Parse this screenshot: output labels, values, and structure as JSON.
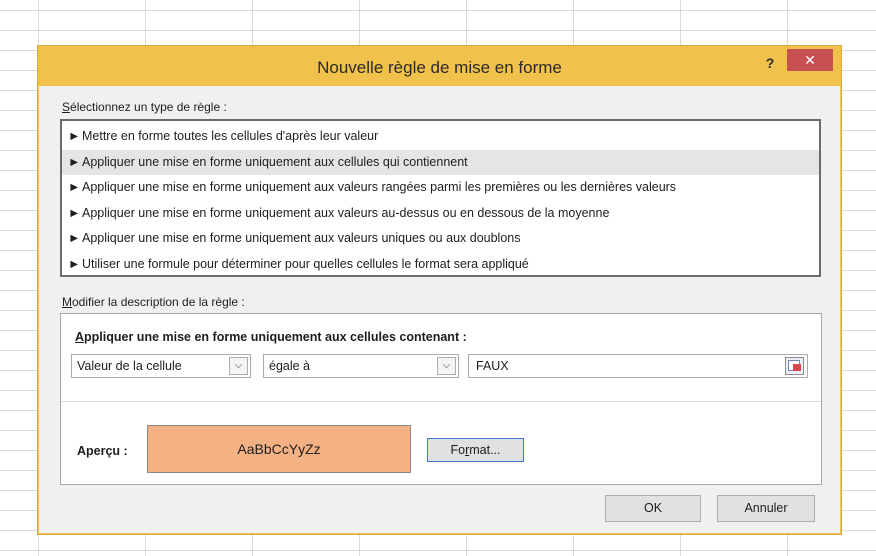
{
  "dialog": {
    "title": "Nouvelle règle de mise en forme",
    "help_label": "?",
    "close_label": "✕"
  },
  "rule_type": {
    "label_prefix": "S",
    "label_rest": "électionnez un type de règle :",
    "items": [
      "Mettre en forme toutes les cellules d'après leur valeur",
      "Appliquer une mise en forme uniquement aux cellules qui contiennent",
      "Appliquer une mise en forme uniquement aux valeurs rangées parmi les premières ou les dernières valeurs",
      "Appliquer une mise en forme uniquement aux valeurs au-dessus ou en dessous de la moyenne",
      "Appliquer une mise en forme uniquement aux valeurs uniques ou aux doublons",
      "Utiliser une formule pour déterminer pour quelles cellules le format sera appliqué"
    ],
    "selected_index": 1,
    "bullet": "►"
  },
  "description": {
    "label_prefix": "M",
    "label_rest": "odifier la description de la règle :",
    "heading_prefix": "A",
    "heading_rest": "ppliquer une mise en forme uniquement aux cellules contenant :",
    "condition_type": "Valeur de la cellule",
    "operator": "égale à",
    "value": "FAUX",
    "dropdown_glyph": "⌵"
  },
  "preview": {
    "label": "Aperçu :",
    "sample_text": "AaBbCcYyZz",
    "fill_color": "#f4b183"
  },
  "buttons": {
    "format_prefix": "Fo",
    "format_key": "r",
    "format_rest": "mat...",
    "ok": "OK",
    "cancel": "Annuler"
  },
  "colors": {
    "titlebar": "#f0c14b",
    "close": "#c75050"
  }
}
